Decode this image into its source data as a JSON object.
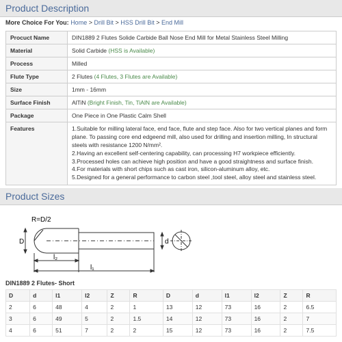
{
  "headers": {
    "desc": "Product Description",
    "sizes": "Product Sizes"
  },
  "more_choice": {
    "label": "More Choice For You: ",
    "items": [
      "Home",
      "Drill Bit",
      "HSS Drill Bit",
      "End Mill"
    ]
  },
  "spec": {
    "name": {
      "k": "Procuct Name",
      "v": "DIN1889 2 Flutes Solide Carbide Ball Nose End Mill for Metal Stainless Steel Milling"
    },
    "material": {
      "k": "Material",
      "v": "Solid Carbide",
      "hint": "(HSS is Available)"
    },
    "process": {
      "k": "Process",
      "v": "Milled"
    },
    "flute": {
      "k": "Flute Type",
      "v": "2 Flutes",
      "hint": "(4 Flutes, 3 Flutes are Available)"
    },
    "size": {
      "k": "Size",
      "v": "1mm - 16mm"
    },
    "finish": {
      "k": "Surface Finish",
      "v": "AlTiN",
      "hint": "(Bright Finish, Tin, TiAlN are Available)"
    },
    "package": {
      "k": "Package",
      "v": "One Piece in One Plastic Calm Shell"
    },
    "features": {
      "k": "Features",
      "v": "1.Suitable for milling lateral face, end face, flute and step face. Also for two vertical planes and form plane. To passing core end edgeend mill, also used for drilling and insertion milling, In structural steels with resistance 1200 N/mm².\n2.Having an excellent self-centering capability, can processing H7 workpiece efficiently.\n3.Processed holes can achieve high position and have a good straightness and surface finish.\n4.For materials with short chips such as cast iron, silicon-aluminum alloy, etc.\n5.Designed for a general performance to carbon steel ,tool steel, alloy steel and stainless steel."
    }
  },
  "diagram_labels": {
    "r": "R=D/2",
    "D": "D",
    "d": "d",
    "l1": "l₁",
    "l2": "l₂"
  },
  "sizes_title": "DIN1889 2 Flutes- Short",
  "size_cols": [
    "D",
    "d",
    "l1",
    "l2",
    "Z",
    "R",
    "D",
    "d",
    "l1",
    "l2",
    "Z",
    "R"
  ],
  "size_rows": [
    [
      "2",
      "6",
      "48",
      "4",
      "2",
      "1",
      "13",
      "12",
      "73",
      "16",
      "2",
      "6.5"
    ],
    [
      "3",
      "6",
      "49",
      "5",
      "2",
      "1.5",
      "14",
      "12",
      "73",
      "16",
      "2",
      "7"
    ],
    [
      "4",
      "6",
      "51",
      "7",
      "2",
      "2",
      "15",
      "12",
      "73",
      "16",
      "2",
      "7.5"
    ]
  ]
}
